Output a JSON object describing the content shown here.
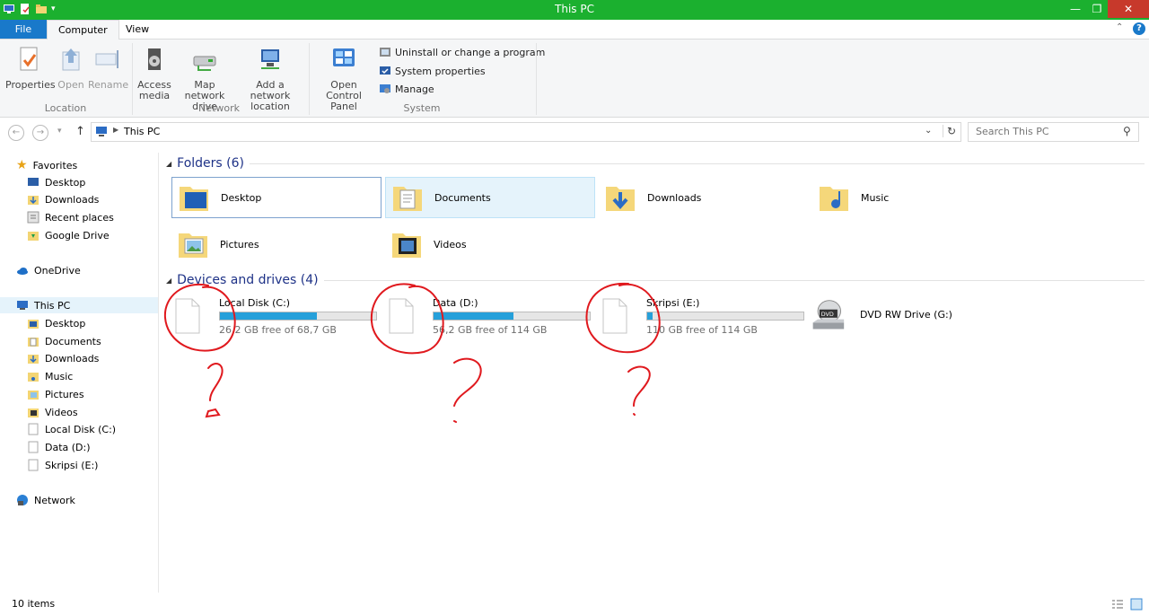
{
  "window": {
    "title": "This PC",
    "minimize_icon": "minimize-icon",
    "maximize_icon": "restore-icon",
    "close_icon": "close-icon"
  },
  "ribbon_tabs": {
    "file": "File",
    "computer": "Computer",
    "view": "View"
  },
  "ribbon": {
    "location": {
      "label": "Location",
      "properties": "Properties",
      "open": "Open",
      "rename": "Rename"
    },
    "network": {
      "label": "Network",
      "access_media": "Access media",
      "map_network_drive": "Map network drive",
      "add_network_location": "Add a network location"
    },
    "system": {
      "label": "System",
      "open_control_panel": "Open Control Panel",
      "uninstall": "Uninstall or change a program",
      "system_properties": "System properties",
      "manage": "Manage"
    }
  },
  "address": {
    "path": "This PC",
    "search_placeholder": "Search This PC"
  },
  "nav": {
    "favorites": "Favorites",
    "favorites_items": [
      "Desktop",
      "Downloads",
      "Recent places",
      "Google Drive"
    ],
    "onedrive": "OneDrive",
    "this_pc": "This PC",
    "this_pc_items": [
      "Desktop",
      "Documents",
      "Downloads",
      "Music",
      "Pictures",
      "Videos",
      "Local Disk (C:)",
      "Data (D:)",
      "Skripsi (E:)"
    ],
    "network": "Network"
  },
  "content": {
    "folders_header": "Folders (6)",
    "folders": [
      "Desktop",
      "Documents",
      "Downloads",
      "Music",
      "Pictures",
      "Videos"
    ],
    "drives_header": "Devices and drives (4)",
    "drives": [
      {
        "name": "Local Disk (C:)",
        "free": "26,2 GB free of 68,7 GB",
        "used_fraction": 0.62
      },
      {
        "name": "Data (D:)",
        "free": "56,2 GB free of 114 GB",
        "used_fraction": 0.51
      },
      {
        "name": "Skripsi (E:)",
        "free": "110 GB free of 114 GB",
        "used_fraction": 0.035
      },
      {
        "name": "DVD RW Drive (G:)"
      }
    ]
  },
  "status": {
    "count": "10 items"
  },
  "colors": {
    "titlebar": "#1bb02f",
    "file_tab": "#1979ca",
    "drive_bar": "#26a0da",
    "annotation": "#e0191e"
  }
}
